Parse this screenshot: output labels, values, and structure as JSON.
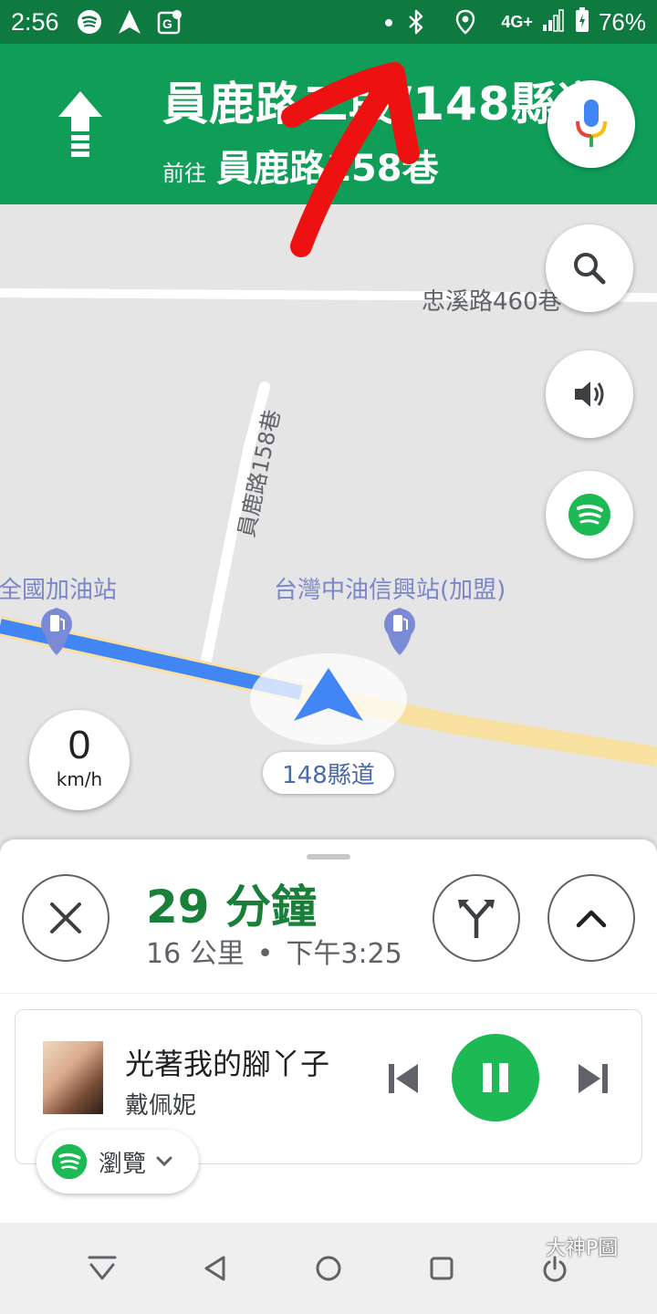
{
  "status_bar": {
    "time": "2:56",
    "network": "4G+",
    "battery": "76%",
    "icons": [
      "spotify-icon",
      "navigation-icon",
      "maps-icon",
      "dot-icon",
      "bluetooth-icon",
      "location-icon",
      "signal-icon",
      "battery-icon"
    ]
  },
  "navigation": {
    "road_title": "員鹿路二段/148縣道",
    "toward_prefix": "前往",
    "toward_road": "員鹿路158巷",
    "maneuver_icon": "straight-arrow-icon",
    "mic_icon": "mic-icon",
    "header_color": "#0f9d58"
  },
  "map": {
    "road_top_label": "忠溪路460巷",
    "road_vertical_label": "員鹿路158巷",
    "poi_left": "全國加油站",
    "poi_right": "台灣中油信興站(加盟)",
    "current_road": "148縣道",
    "speed": {
      "value": "0",
      "unit": "km/h"
    },
    "route_color": "#4285f4",
    "buttons": [
      "search-icon",
      "volume-icon",
      "spotify-icon"
    ]
  },
  "trip": {
    "eta": "29 分鐘",
    "distance": "16 公里",
    "separator": "•",
    "arrival": "下午3:25",
    "eta_color": "#188038"
  },
  "media": {
    "title": "光著我的腳丫子",
    "artist": "戴佩妮",
    "browse_label": "瀏覽",
    "accent": "#1db954"
  },
  "system_nav": {
    "watermark": "大神P圖",
    "buttons": [
      "dropdown-nav-icon",
      "back-icon",
      "home-icon",
      "recents-icon",
      "power-icon"
    ]
  }
}
